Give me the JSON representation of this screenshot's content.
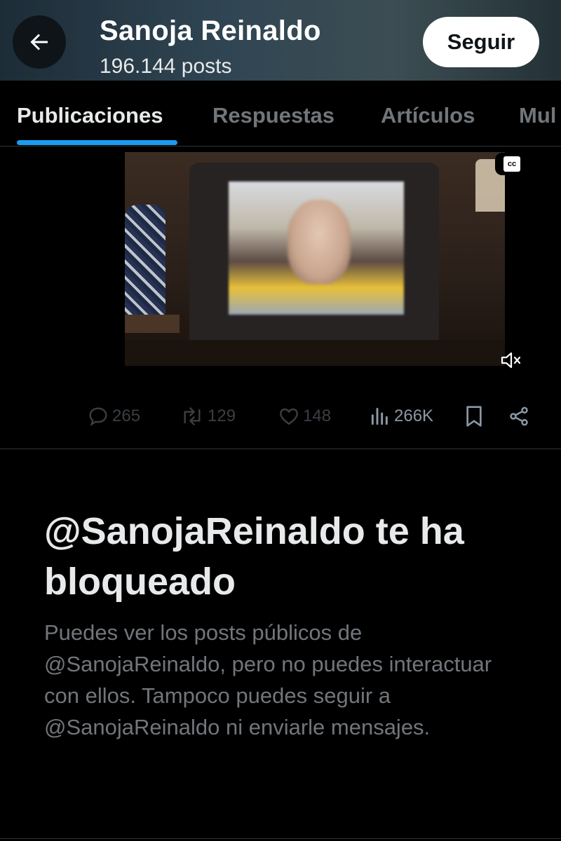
{
  "header": {
    "title": "Sanoja Reinaldo",
    "posts_count": "196.144 posts",
    "follow_label": "Seguir",
    "back_icon": "arrow-left-icon"
  },
  "tabs": [
    {
      "label": "Publicaciones",
      "active": true
    },
    {
      "label": "Respuestas",
      "active": false
    },
    {
      "label": "Artículos",
      "active": false
    },
    {
      "label": "Mul",
      "active": false
    }
  ],
  "video": {
    "cc_label": "cc",
    "mute_icon": "volume-muted-icon"
  },
  "post_actions": {
    "replies": "265",
    "reposts": "129",
    "likes": "148",
    "views": "266K"
  },
  "blocked": {
    "title": "@SanojaReinaldo te ha bloqueado",
    "body": "Puedes ver los posts públicos de @SanojaReinaldo, pero no puedes interactuar con ellos. Tampoco puedes seguir a @SanojaReinaldo ni enviarle mensajes."
  },
  "colors": {
    "accent": "#1d9bf0",
    "background": "#000000",
    "muted_text": "#71767b",
    "primary_text": "#e7e9ea"
  }
}
